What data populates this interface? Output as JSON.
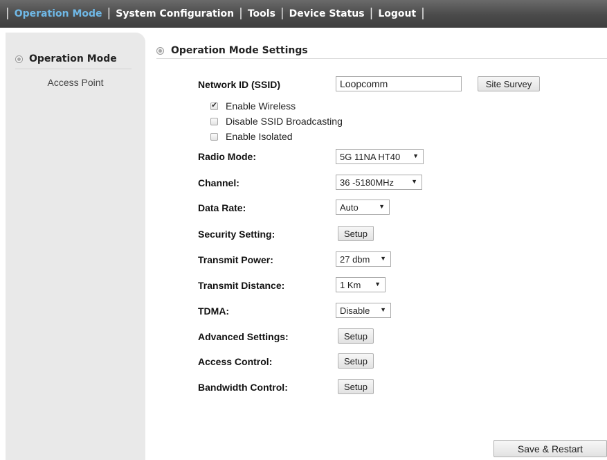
{
  "nav": {
    "items": [
      {
        "label": "Operation Mode",
        "active": true
      },
      {
        "label": "System Configuration"
      },
      {
        "label": "Tools"
      },
      {
        "label": "Device Status"
      },
      {
        "label": "Logout"
      }
    ],
    "separator": "|"
  },
  "sidebar": {
    "title": "Operation Mode",
    "items": [
      {
        "label": "Access Point"
      }
    ]
  },
  "section": {
    "title": "Operation Mode Settings"
  },
  "form": {
    "ssid": {
      "label": "Network ID (SSID)",
      "value": "Loopcomm",
      "site_survey_label": "Site Survey"
    },
    "checkboxes": [
      {
        "label": "Enable Wireless",
        "checked": true
      },
      {
        "label": "Disable SSID Broadcasting",
        "checked": false
      },
      {
        "label": "Enable Isolated",
        "checked": false
      }
    ],
    "radio_mode": {
      "label": "Radio Mode:",
      "value": "5G 11NA HT40"
    },
    "channel": {
      "label": "Channel:",
      "value": "36 -5180MHz"
    },
    "data_rate": {
      "label": "Data Rate:",
      "value": "Auto"
    },
    "security": {
      "label": "Security Setting:",
      "button": "Setup"
    },
    "transmit_power": {
      "label": "Transmit Power:",
      "value": "27 dbm"
    },
    "transmit_distance": {
      "label": "Transmit Distance:",
      "value": "1 Km"
    },
    "tdma": {
      "label": "TDMA:",
      "value": "Disable"
    },
    "advanced": {
      "label": "Advanced Settings:",
      "button": "Setup"
    },
    "access_control": {
      "label": "Access Control:",
      "button": "Setup"
    },
    "bandwidth": {
      "label": "Bandwidth Control:",
      "button": "Setup"
    }
  },
  "actions": {
    "save_restart": "Save & Restart"
  },
  "icons": {
    "dropdown": "▼"
  },
  "colors": {
    "nav_active": "#6fb8e6",
    "nav_bg": "#4a4a4a",
    "sidebar_bg": "#e9e9e9"
  }
}
